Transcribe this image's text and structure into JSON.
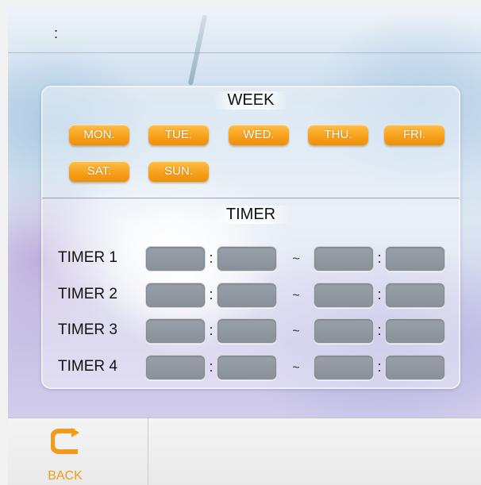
{
  "header": {
    "time_colon": ":"
  },
  "week": {
    "title": "WEEK",
    "days": [
      "MON.",
      "TUE.",
      "WED.",
      "THU.",
      "FRI.",
      "SAT.",
      "SUN."
    ]
  },
  "timer": {
    "title": "TIMER",
    "rows": [
      {
        "label": "TIMER 1"
      },
      {
        "label": "TIMER 2"
      },
      {
        "label": "TIMER 3"
      },
      {
        "label": "TIMER 4"
      }
    ],
    "colon": ":",
    "range_sep": "~"
  },
  "footer": {
    "back_label": "BACK"
  },
  "colors": {
    "accent": "#f29a1a",
    "timebox": "#8f959e"
  },
  "icons": {
    "back": "back-arrow-icon"
  }
}
